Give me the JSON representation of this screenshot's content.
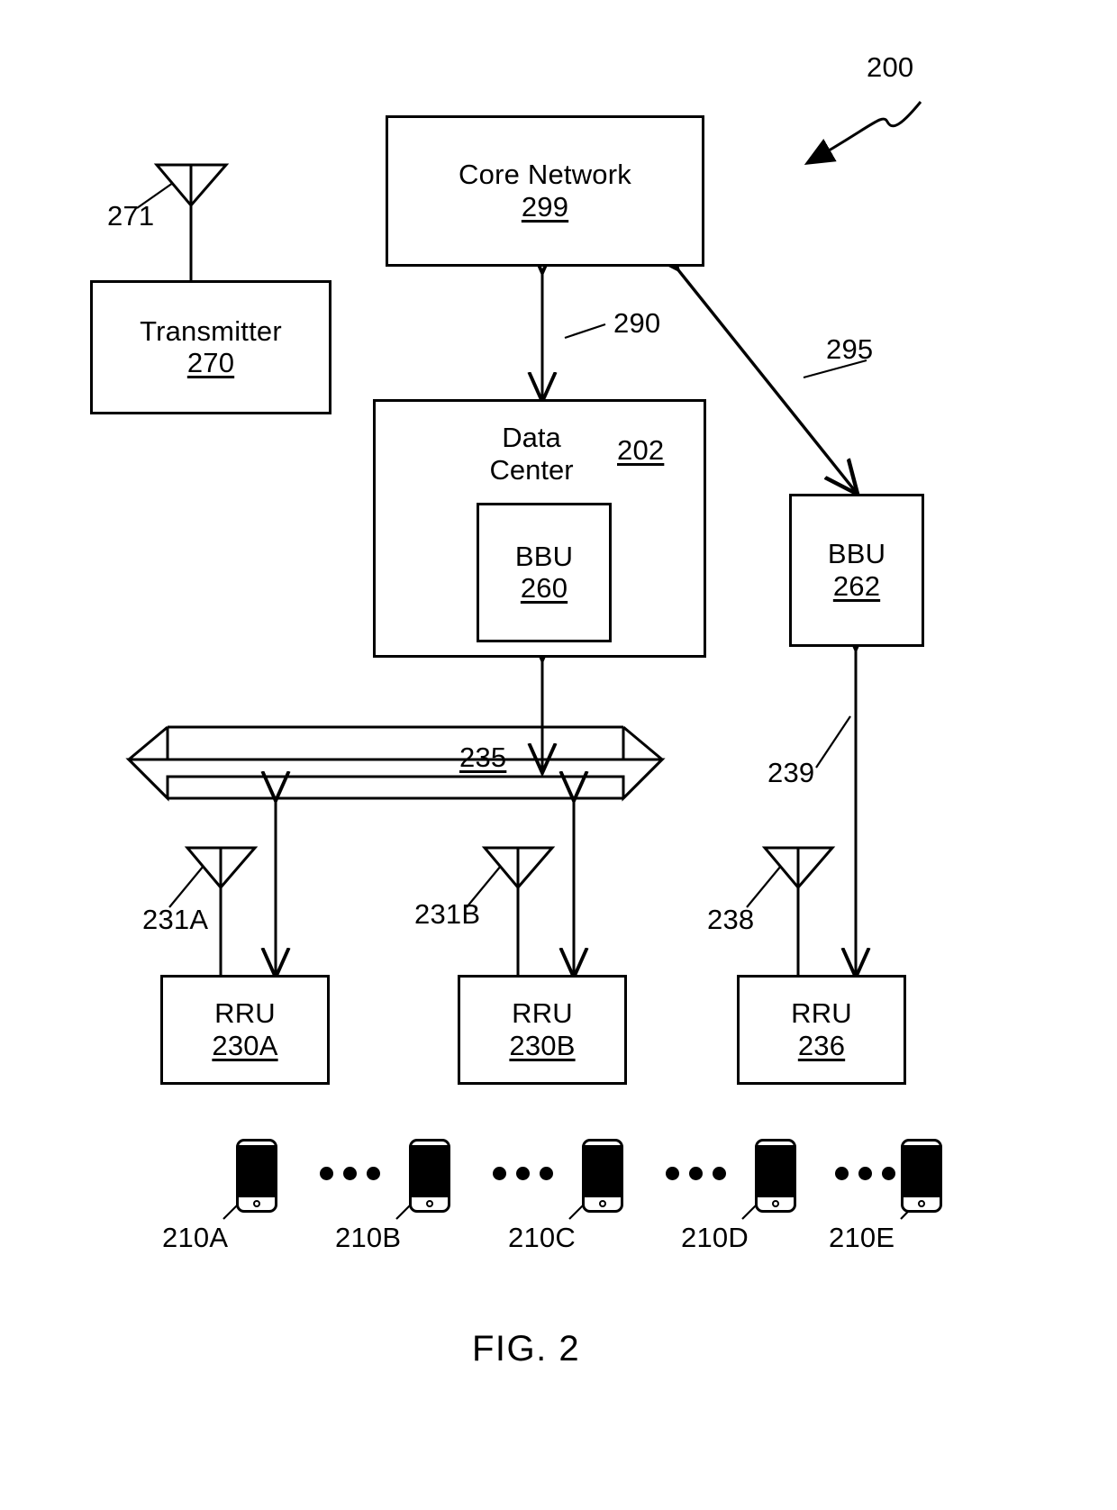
{
  "figure": {
    "caption": "FIG. 2",
    "system_ref": "200"
  },
  "blocks": {
    "core_network": {
      "label": "Core Network",
      "ref": "299"
    },
    "transmitter": {
      "label": "Transmitter",
      "ref": "270"
    },
    "data_center": {
      "label": "Data\nCenter",
      "ref": "202"
    },
    "bbu_260": {
      "label": "BBU",
      "ref": "260"
    },
    "bbu_262": {
      "label": "BBU",
      "ref": "262"
    },
    "rru_230a": {
      "label": "RRU",
      "ref": "230A"
    },
    "rru_230b": {
      "label": "RRU",
      "ref": "230B"
    },
    "rru_236": {
      "label": "RRU",
      "ref": "236"
    }
  },
  "antennas": [
    {
      "name": "transmitter-antenna",
      "ref": "271"
    },
    {
      "name": "rru-230a-antenna",
      "ref": "231A"
    },
    {
      "name": "rru-230b-antenna",
      "ref": "231B"
    },
    {
      "name": "rru-236-antenna",
      "ref": "238"
    }
  ],
  "links": {
    "core_to_datacenter": "290",
    "core_to_bbu262": "295",
    "fronthaul_bus": "235",
    "bbu262_to_rru236": "239"
  },
  "user_equipment": [
    {
      "ref": "210A"
    },
    {
      "ref": "210B"
    },
    {
      "ref": "210C"
    },
    {
      "ref": "210D"
    },
    {
      "ref": "210E"
    }
  ],
  "colors": {
    "stroke": "#000000",
    "background": "#ffffff"
  }
}
